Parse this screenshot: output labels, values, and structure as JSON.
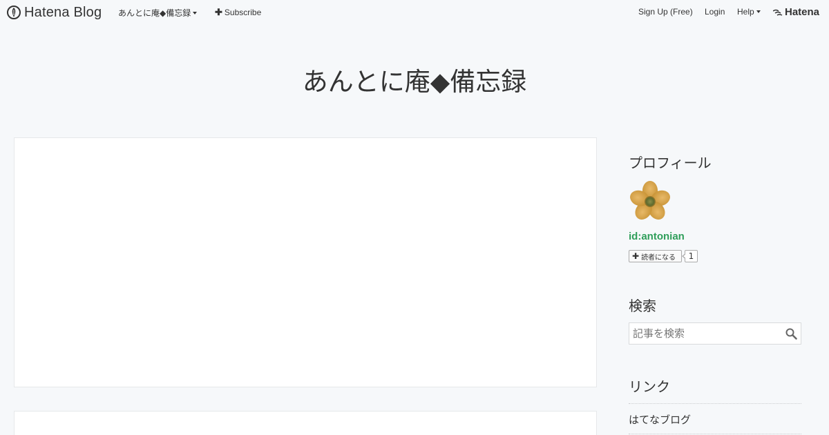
{
  "topbar": {
    "brand": "Hatena Blog",
    "blog_menu": "あんとに庵◆備忘録",
    "subscribe": "Subscribe",
    "signup": "Sign Up (Free)",
    "login": "Login",
    "help": "Help",
    "hatena": "Hatena"
  },
  "blog": {
    "title": "あんとに庵◆備忘録"
  },
  "sidebar": {
    "profile": {
      "title": "プロフィール",
      "user_id": "id:antonian",
      "subscribe_label": "読者になる",
      "subscriber_count": "1"
    },
    "search": {
      "title": "検索",
      "placeholder": "記事を検索"
    },
    "links": {
      "title": "リンク",
      "items": [
        "はてなブログ"
      ]
    }
  },
  "colors": {
    "background": "#f6f8fa",
    "text": "#333333",
    "profile_id": "#2f9e5a"
  },
  "icons": {
    "brand": "hatena-blog-pen-icon",
    "subscribe": "plus-icon",
    "search": "search-icon",
    "avatar": "flower-avatar"
  }
}
